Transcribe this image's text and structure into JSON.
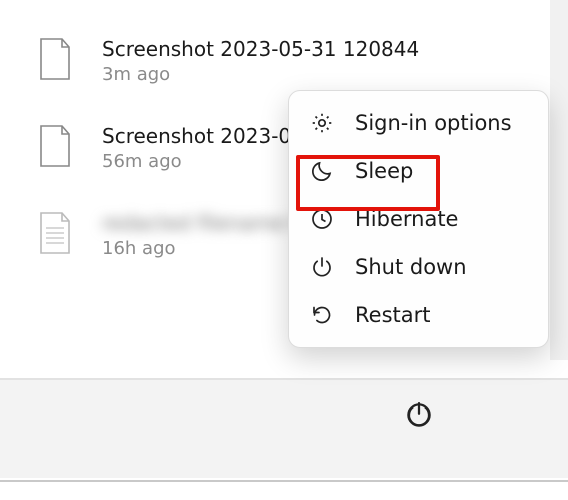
{
  "files": [
    {
      "name": "Screenshot 2023-05-31 120844",
      "time": "3m ago",
      "blurred": false
    },
    {
      "name": "Screenshot 2023-0",
      "time": "56m ago",
      "blurred": false
    },
    {
      "name": "redacted filename text",
      "time": "16h ago",
      "blurred": true
    }
  ],
  "menu": {
    "items": [
      {
        "label": "Sign-in options",
        "icon": "gear"
      },
      {
        "label": "Sleep",
        "icon": "moon"
      },
      {
        "label": "Hibernate",
        "icon": "clock"
      },
      {
        "label": "Shut down",
        "icon": "power"
      },
      {
        "label": "Restart",
        "icon": "restart"
      }
    ]
  },
  "tray": {
    "power_icon": "power"
  }
}
